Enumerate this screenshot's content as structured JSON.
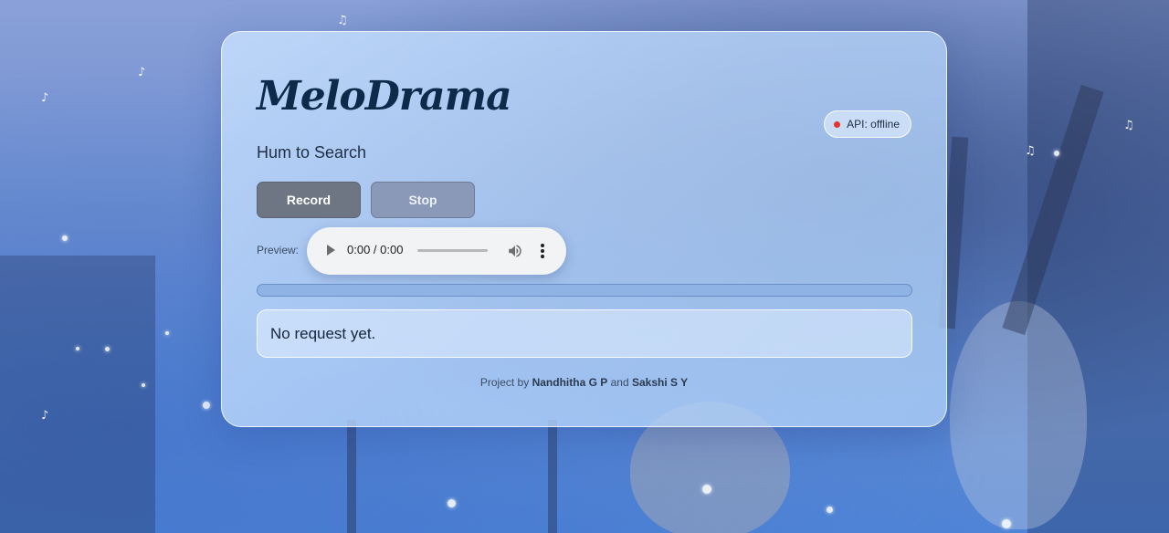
{
  "app": {
    "logo_text": "MeloDrama",
    "subtitle": "Hum to Search"
  },
  "api_status": {
    "text": "API: offline",
    "dot_color": "#e2342b"
  },
  "controls": {
    "record_label": "Record",
    "stop_label": "Stop"
  },
  "preview": {
    "label": "Preview:",
    "time": "0:00 / 0:00",
    "icons": [
      "play-icon",
      "volume-icon",
      "more-options-icon"
    ]
  },
  "status": {
    "progress_fraction": 1.0,
    "message": "No request yet."
  },
  "footer": {
    "prefix": "Project by",
    "author1": "Nandhitha G P",
    "joiner": "and",
    "author2": "Sakshi S Y"
  },
  "colors": {
    "logo": "#0d2a4a",
    "record_button": "#6e7583",
    "stop_button": "#8a99b8",
    "progress_bar": "#8fb3e4"
  }
}
